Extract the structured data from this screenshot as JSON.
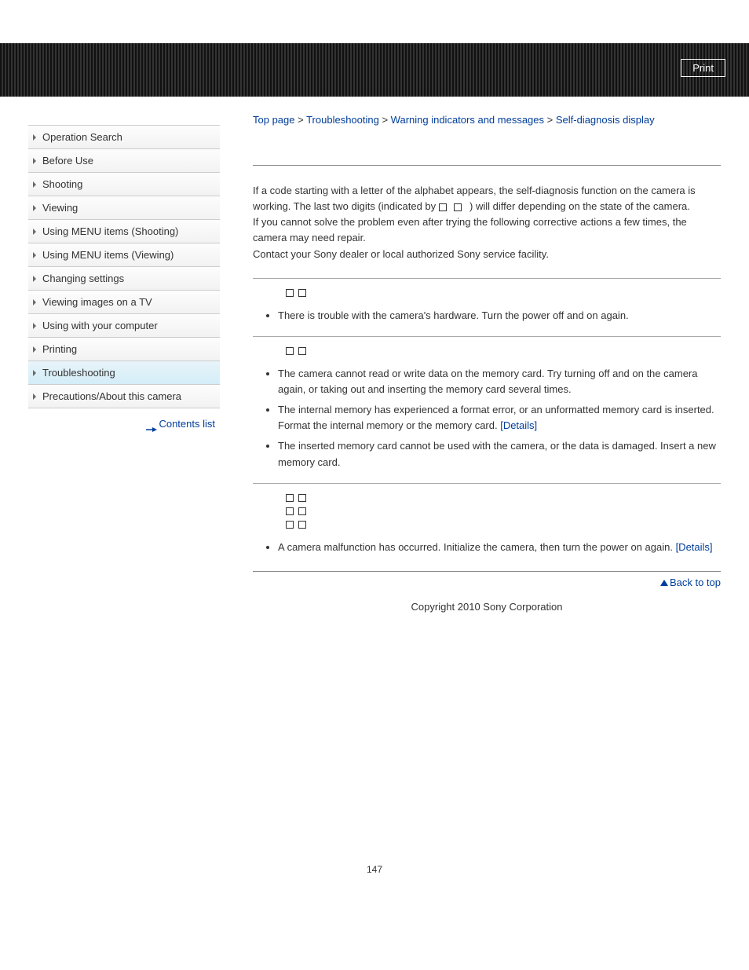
{
  "header": {
    "print": "Print"
  },
  "breadcrumb": {
    "items": [
      "Top page",
      "Troubleshooting",
      "Warning indicators and messages",
      "Self-diagnosis display"
    ],
    "sep": ">"
  },
  "sidebar": {
    "items": [
      {
        "label": "Operation Search",
        "active": false
      },
      {
        "label": "Before Use",
        "active": false
      },
      {
        "label": "Shooting",
        "active": false
      },
      {
        "label": "Viewing",
        "active": false
      },
      {
        "label": "Using MENU items (Shooting)",
        "active": false
      },
      {
        "label": "Using MENU items (Viewing)",
        "active": false
      },
      {
        "label": "Changing settings",
        "active": false
      },
      {
        "label": "Viewing images on a TV",
        "active": false
      },
      {
        "label": "Using with your computer",
        "active": false
      },
      {
        "label": "Printing",
        "active": false
      },
      {
        "label": "Troubleshooting",
        "active": true
      },
      {
        "label": "Precautions/About this camera",
        "active": false
      }
    ],
    "contents_list": "Contents list"
  },
  "intro": {
    "p1a": "If a code starting with a letter of the alphabet appears, the self-diagnosis function on the camera is working. The last two digits (indicated by ",
    "p1b": " ) will differ depending on the state of the camera.",
    "p2": "If you cannot solve the problem even after trying the following corrective actions a few times, the camera may need repair.",
    "p3": "Contact your Sony dealer or local authorized Sony service facility."
  },
  "sections": [
    {
      "codes": 1,
      "bullets": [
        {
          "text": "There is trouble with the camera's hardware. Turn the power off and on again."
        }
      ]
    },
    {
      "codes": 1,
      "bullets": [
        {
          "text": "The camera cannot read or write data on the memory card. Try turning off and on the camera again, or taking out and inserting the memory card several times."
        },
        {
          "text": "The internal memory has experienced a format error, or an unformatted memory card is inserted. Format the internal memory or the memory card. ",
          "link": "[Details]"
        },
        {
          "text": "The inserted memory card cannot be used with the camera, or the data is damaged. Insert a new memory card."
        }
      ]
    },
    {
      "codes": 3,
      "bullets": [
        {
          "text": "A camera malfunction has occurred. Initialize the camera, then turn the power on again. ",
          "link": "[Details]"
        }
      ]
    }
  ],
  "back_to_top": "Back to top",
  "copyright": "Copyright 2010 Sony Corporation",
  "page_number": "147"
}
